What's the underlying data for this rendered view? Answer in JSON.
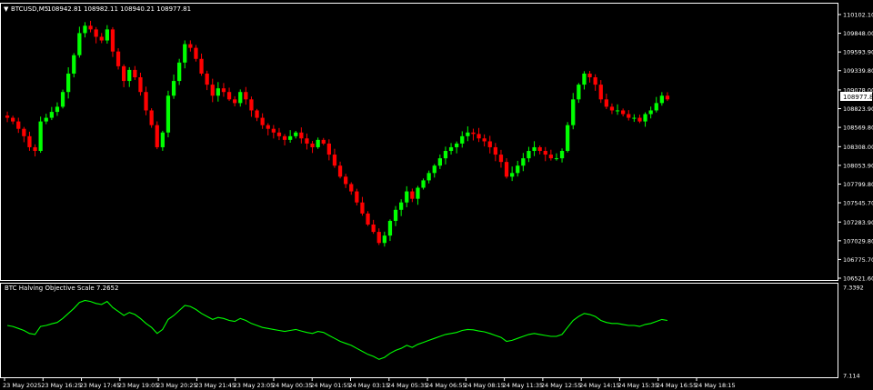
{
  "header": {
    "symbol_label": "BTCUSD,M5",
    "ohlc_text": "108942.81 108982.11 108940.21 108977.81"
  },
  "indicator": {
    "label": "BTC Halving Objective Scale 7.2652"
  },
  "colors": {
    "background": "#000000",
    "frame": "#ffffff",
    "bull": "#00ff00",
    "bear": "#ff0000",
    "indicator_line": "#00ff00",
    "price_tag_bg": "#ffffff",
    "price_tag_fg": "#000000"
  },
  "chart_data": [
    {
      "type": "candlestick",
      "title": "BTCUSD,M5",
      "ylim": [
        106521.6,
        110102.1
      ],
      "y_ticks": [
        "110102.10",
        "109848.00",
        "109593.90",
        "109339.80",
        "109078.00",
        "108823.90",
        "108569.80",
        "108308.00",
        "108053.90",
        "107799.80",
        "107545.70",
        "107283.90",
        "107029.80",
        "106775.70",
        "106521.60"
      ],
      "current_price_label": "108977.81",
      "y_ticks_numeric": [
        110102.1,
        109848.0,
        109593.9,
        109339.8,
        109078.0,
        108823.9,
        108569.8,
        108308.0,
        108053.9,
        107799.8,
        107545.7,
        107283.9,
        107029.8,
        106775.7,
        106521.6
      ],
      "current_price": 108977.81,
      "close_series": [
        108700,
        108650,
        108550,
        108450,
        108300,
        108250,
        108650,
        108700,
        108780,
        108850,
        109050,
        109300,
        109550,
        109850,
        109950,
        109900,
        109800,
        109750,
        109900,
        109600,
        109400,
        109200,
        109350,
        109250,
        109050,
        108800,
        108600,
        108300,
        108500,
        109000,
        109200,
        109450,
        109700,
        109650,
        109500,
        109300,
        109150,
        109000,
        109100,
        109050,
        108950,
        108900,
        109050,
        108950,
        108800,
        108700,
        108600,
        108550,
        108500,
        108450,
        108400,
        108450,
        108500,
        108420,
        108350,
        108300,
        108400,
        108350,
        108200,
        108050,
        107900,
        107800,
        107700,
        107550,
        107400,
        107250,
        107150,
        107000,
        107100,
        107300,
        107450,
        107550,
        107700,
        107600,
        107750,
        107850,
        107950,
        108050,
        108150,
        108250,
        108300,
        108350,
        108450,
        108500,
        108480,
        108420,
        108380,
        108300,
        108200,
        108100,
        107900,
        107950,
        108050,
        108150,
        108250,
        108300,
        108250,
        108200,
        108150,
        108150,
        108250,
        108600,
        108950,
        109150,
        109300,
        109250,
        109150,
        108950,
        108850,
        108800,
        108800,
        108750,
        108700,
        108700,
        108650,
        108750,
        108800,
        108900,
        109000,
        108950
      ]
    },
    {
      "type": "line",
      "title": "BTC Halving Objective Scale 7.2652",
      "y_ticks": [
        "7.3392",
        "7.114"
      ],
      "y_ticks_numeric": [
        7.3392,
        7.114
      ],
      "ylim": [
        7.114,
        7.3392
      ],
      "x_tick_labels": [
        "23 May 2025",
        "23 May 16:25",
        "23 May 17:45",
        "23 May 19:05",
        "23 May 20:25",
        "23 May 21:45",
        "23 May 23:05",
        "24 May 00:35",
        "24 May 01:55",
        "24 May 03:15",
        "24 May 05:35",
        "24 May 06:55",
        "24 May 08:15",
        "24 May 11:35",
        "24 May 12:55",
        "24 May 14:15",
        "24 May 15:35",
        "24 May 16:55",
        "24 May 18:15"
      ]
    }
  ]
}
